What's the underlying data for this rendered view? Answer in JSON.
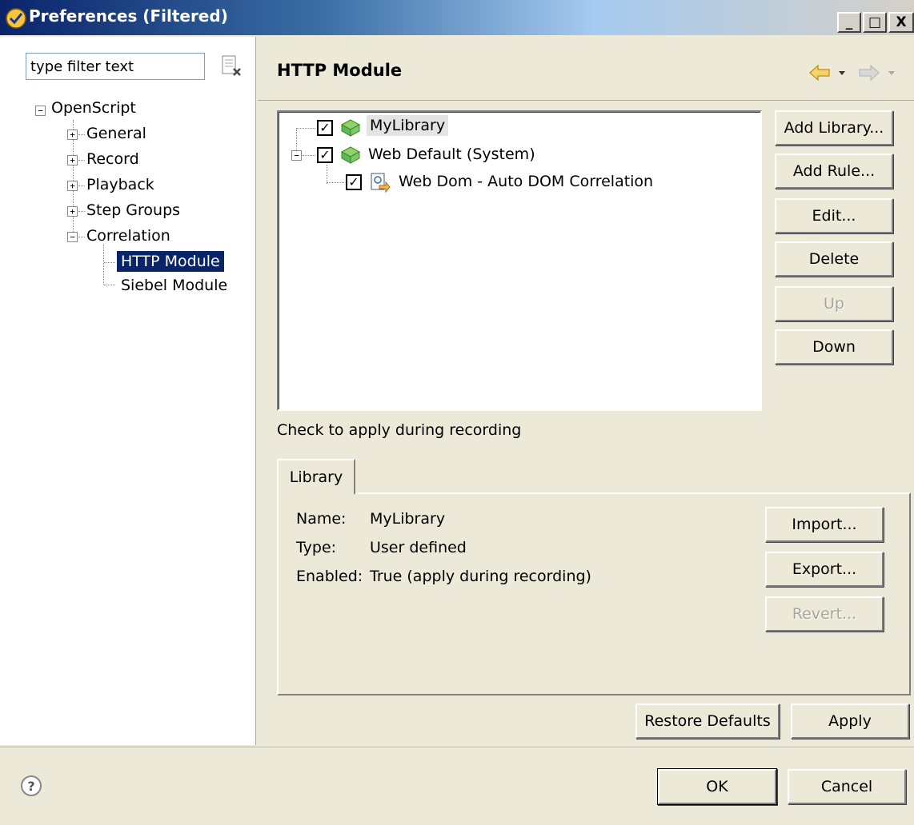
{
  "window": {
    "title": "Preferences (Filtered)",
    "minimize_glyph": "_",
    "maximize_glyph": "□",
    "close_glyph": "X"
  },
  "left": {
    "filter_placeholder": "type filter text",
    "filter_value": "type filter text",
    "tree": [
      {
        "label": "OpenScript",
        "toggle": "−"
      },
      {
        "label": "General",
        "toggle": "+"
      },
      {
        "label": "Record",
        "toggle": "+"
      },
      {
        "label": "Playback",
        "toggle": "+"
      },
      {
        "label": "Step Groups",
        "toggle": "+"
      },
      {
        "label": "Correlation",
        "toggle": "−"
      },
      {
        "label": "HTTP Module",
        "selected": true
      },
      {
        "label": "Siebel Module"
      }
    ]
  },
  "page": {
    "title": "HTTP Module",
    "libraries": [
      {
        "label": "MyLibrary",
        "checked": true,
        "highlighted": true
      },
      {
        "label": "Web Default (System)",
        "checked": true,
        "toggle": "−"
      },
      {
        "label": "Web Dom - Auto DOM Correlation",
        "checked": true
      }
    ],
    "buttons": {
      "add_library": "Add Library...",
      "add_rule": "Add Rule...",
      "edit": "Edit...",
      "delete": "Delete",
      "up": "Up",
      "down": "Down"
    },
    "check_hint": "Check to apply during recording",
    "tab_label": "Library",
    "details": {
      "name_label": "Name:",
      "name_value": "MyLibrary",
      "type_label": "Type:",
      "type_value": "User defined",
      "enabled_label": "Enabled:",
      "enabled_value": "True (apply during recording)"
    },
    "detail_buttons": {
      "import": "Import...",
      "export": "Export...",
      "revert": "Revert..."
    },
    "restore_defaults": "Restore Defaults",
    "apply": "Apply"
  },
  "footer": {
    "help_glyph": "?",
    "ok": "OK",
    "cancel": "Cancel"
  },
  "colors": {
    "title_bar": "#0a246a",
    "selection": "#0a246a",
    "dialog_bg": "#ece9d8",
    "library_icon": "#5cb85c",
    "nav_arrow": "#f0c040"
  }
}
